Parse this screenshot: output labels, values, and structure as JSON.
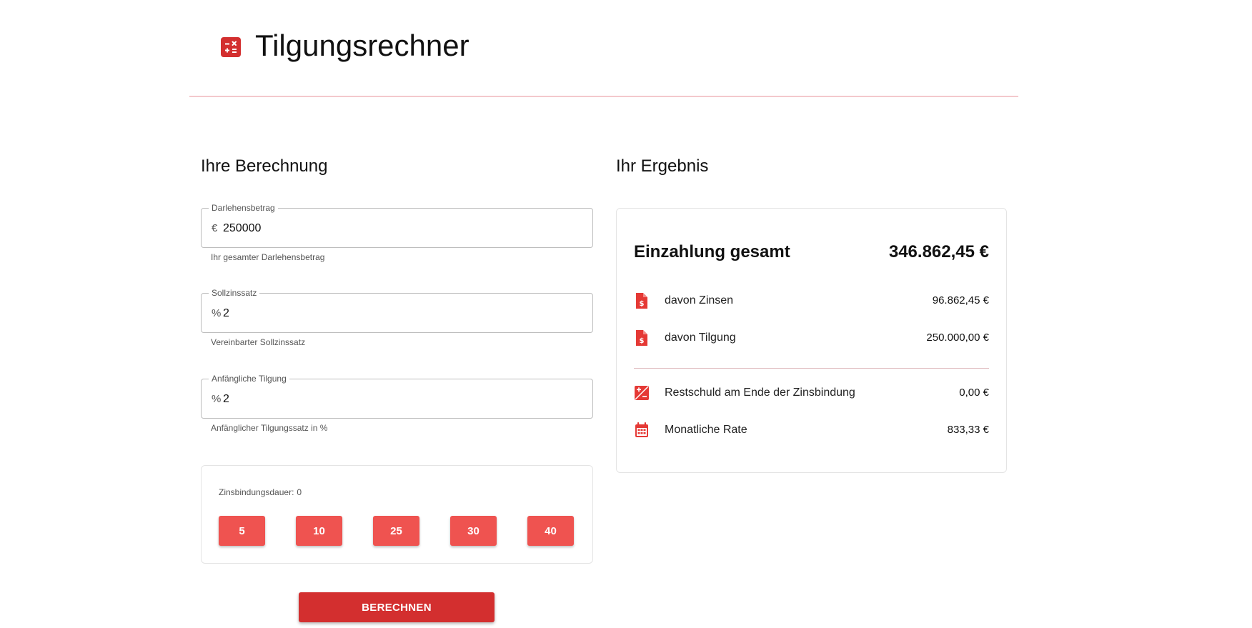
{
  "header": {
    "title": "Tilgungsrechner",
    "icon": "calculator-icon"
  },
  "colors": {
    "primary": "#d32f2f",
    "accent": "#ef5350",
    "divider": "#f3c9cc"
  },
  "form": {
    "heading": "Ihre Berechnung",
    "loan_amount": {
      "label": "Darlehensbetrag",
      "prefix": "€",
      "value": "250000",
      "helper": "Ihr gesamter Darlehensbetrag"
    },
    "interest_rate": {
      "label": "Sollzinssatz",
      "prefix": "%",
      "value": "2",
      "helper": "Vereinbarter Sollzinssatz"
    },
    "initial_repayment": {
      "label": "Anfängliche Tilgung",
      "prefix": "%",
      "value": "2",
      "helper": "Anfänglicher Tilgungssatz in %"
    },
    "fixed_period": {
      "label": "Zinsbindungsdauer:",
      "value": "0",
      "options": [
        "5",
        "10",
        "25",
        "30",
        "40"
      ]
    },
    "calculate_label": "BERECHNEN"
  },
  "result": {
    "heading": "Ihr Ergebnis",
    "total": {
      "label": "Einzahlung gesamt",
      "value": "346.862,45 €"
    },
    "rows": [
      {
        "icon": "invoice-dollar-icon",
        "label": "davon Zinsen",
        "value": "96.862,45 €"
      },
      {
        "icon": "invoice-dollar-icon",
        "label": "davon Tilgung",
        "value": "250.000,00 €"
      },
      {
        "icon": "plus-minus-box-icon",
        "label": "Restschuld am Ende der Zinsbindung",
        "value": "0,00 €"
      },
      {
        "icon": "calendar-icon",
        "label": "Monatliche Rate",
        "value": "833,33 €"
      }
    ]
  }
}
